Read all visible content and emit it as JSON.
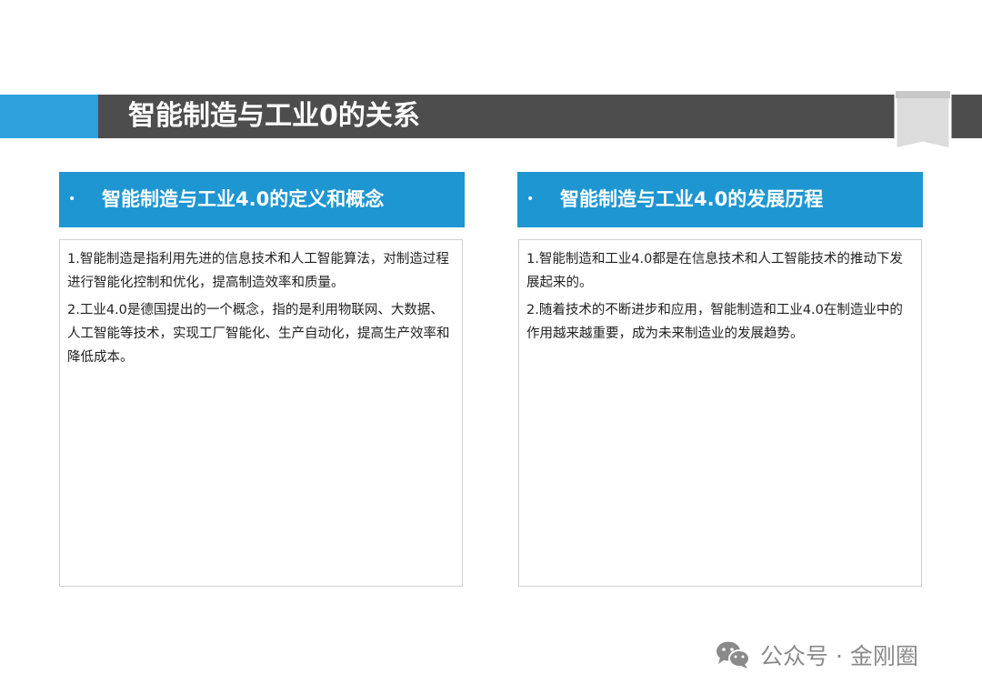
{
  "slide": {
    "title": "智能制造与工业0的关系"
  },
  "panels": [
    {
      "bullet": "•",
      "heading": "智能制造与工业4.0的定义和概念",
      "paragraphs": [
        "1.智能制造是指利用先进的信息技术和人工智能算法，对制造过程进行智能化控制和优化，提高制造效率和质量。",
        "2.工业4.0是德国提出的一个概念，指的是利用物联网、大数据、人工智能等技术，实现工厂智能化、生产自动化，提高生产效率和降低成本。"
      ]
    },
    {
      "bullet": "•",
      "heading": "智能制造与工业4.0的发展历程",
      "paragraphs": [
        "1.智能制造和工业4.0都是在信息技术和人工智能技术的推动下发展起来的。",
        "2.随着技术的不断进步和应用，智能制造和工业4.0在制造业中的作用越来越重要，成为未来制造业的发展趋势。"
      ]
    }
  ],
  "watermark": {
    "icon": "wechat-icon",
    "text": "公众号 · 金刚圈"
  },
  "colors": {
    "title_bar": "#4d4d4d",
    "title_accent": "#2ea2dc",
    "panel_header": "#1e96d2"
  }
}
